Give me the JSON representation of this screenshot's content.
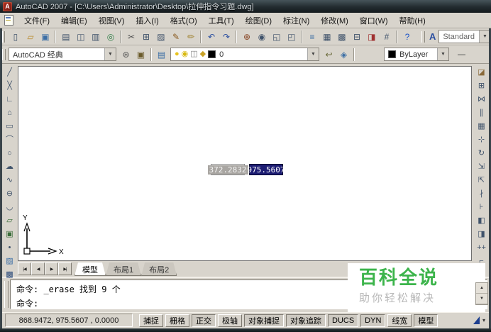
{
  "titlebar": {
    "logo_glyph": "A",
    "title": "AutoCAD 2007 - [C:\\Users\\Administrator\\Desktop\\拉伸指令习题.dwg]"
  },
  "menubar": {
    "items": [
      {
        "name": "file",
        "label": "文件(F)"
      },
      {
        "name": "edit",
        "label": "编辑(E)"
      },
      {
        "name": "view",
        "label": "视图(V)"
      },
      {
        "name": "insert",
        "label": "插入(I)"
      },
      {
        "name": "format",
        "label": "格式(O)"
      },
      {
        "name": "tools",
        "label": "工具(T)"
      },
      {
        "name": "draw",
        "label": "绘图(D)"
      },
      {
        "name": "dimension",
        "label": "标注(N)"
      },
      {
        "name": "modify",
        "label": "修改(M)"
      },
      {
        "name": "window",
        "label": "窗口(W)"
      },
      {
        "name": "help",
        "label": "帮助(H)"
      }
    ]
  },
  "toolbars": {
    "standard": {
      "groups": [
        [
          {
            "name": "new",
            "glyph": "▯"
          },
          {
            "name": "open",
            "glyph": "▱",
            "color": "#b98a2a"
          },
          {
            "name": "save",
            "glyph": "▣",
            "color": "#3b6ea5"
          }
        ],
        [
          {
            "name": "plot",
            "glyph": "▤"
          },
          {
            "name": "plot-preview",
            "glyph": "◫"
          },
          {
            "name": "publish",
            "glyph": "▥"
          },
          {
            "name": "etransmit",
            "glyph": "◎",
            "color": "#2e7d46"
          }
        ],
        [
          {
            "name": "cut",
            "glyph": "✂",
            "color": "#555555"
          },
          {
            "name": "copy",
            "glyph": "⊞"
          },
          {
            "name": "paste",
            "glyph": "▨"
          },
          {
            "name": "match-properties",
            "glyph": "✎",
            "color": "#8a5a1e"
          },
          {
            "name": "block-editor",
            "glyph": "✏",
            "color": "#9a7a20"
          }
        ],
        [
          {
            "name": "undo",
            "glyph": "↶",
            "color": "#2a4ea0"
          },
          {
            "name": "redo",
            "glyph": "↷",
            "color": "#2a4ea0"
          }
        ],
        [
          {
            "name": "pan",
            "glyph": "⊕",
            "color": "#8a4a2a"
          },
          {
            "name": "zoom-realtime",
            "glyph": "◉"
          },
          {
            "name": "zoom-window",
            "glyph": "◱"
          },
          {
            "name": "zoom-previous",
            "glyph": "◰"
          }
        ],
        [
          {
            "name": "properties",
            "glyph": "≡",
            "color": "#3b6ea5"
          },
          {
            "name": "designcenter",
            "glyph": "▦"
          },
          {
            "name": "tool-palettes",
            "glyph": "▩"
          },
          {
            "name": "sheet-set-manager",
            "glyph": "⊟"
          },
          {
            "name": "markup-set-manager",
            "glyph": "◨",
            "color": "#a03030"
          },
          {
            "name": "quickcalc",
            "glyph": "#"
          }
        ],
        [
          {
            "name": "help",
            "glyph": "?",
            "color": "#1a52c8"
          }
        ]
      ]
    },
    "styles": {
      "icon_glyph": "A",
      "text_style": "Standard"
    },
    "workspace": {
      "value": "AutoCAD 经典",
      "buttons": [
        {
          "name": "workspace-settings",
          "glyph": "⊛",
          "color": "#555555"
        },
        {
          "name": "workspace-save",
          "glyph": "▣",
          "color": "#6a5a2a"
        }
      ]
    },
    "layers": {
      "manager_button": {
        "name": "layer-properties-manager",
        "glyph": "▤",
        "color": "#3b6ea5"
      },
      "combo": {
        "icons": [
          {
            "name": "layer-on-bulb",
            "glyph": "●",
            "color": "#e8c31f"
          },
          {
            "name": "layer-freeze-sun",
            "glyph": "◉",
            "color": "#d8b90f"
          },
          {
            "name": "layer-plot",
            "glyph": "◫",
            "color": "#7a7a7a"
          },
          {
            "name": "layer-lock",
            "glyph": "◆",
            "color": "#c9a227"
          }
        ],
        "color_swatch": "#000000",
        "current_layer": "0"
      },
      "buttons_right": [
        {
          "name": "layer-previous",
          "glyph": "↩",
          "color": "#6a6a3a"
        },
        {
          "name": "layer-states",
          "glyph": "◈",
          "color": "#3b6ea5"
        }
      ],
      "color_combo": {
        "swatch": "#000000",
        "label": "ByLayer"
      },
      "linetype_hint": "—"
    }
  },
  "draw_tools": [
    {
      "name": "line",
      "glyph": "╱"
    },
    {
      "name": "construction-line",
      "glyph": "╳"
    },
    {
      "name": "polyline",
      "glyph": "∟"
    },
    {
      "name": "polygon",
      "glyph": "⌂"
    },
    {
      "name": "rectangle",
      "glyph": "▭"
    },
    {
      "name": "arc",
      "glyph": "⌒"
    },
    {
      "name": "circle",
      "glyph": "○"
    },
    {
      "name": "revision-cloud",
      "glyph": "☁"
    },
    {
      "name": "spline",
      "glyph": "∿"
    },
    {
      "name": "ellipse",
      "glyph": "⊖"
    },
    {
      "name": "ellipse-arc",
      "glyph": "◡"
    },
    {
      "name": "insert-block",
      "glyph": "▱",
      "color": "#3b6e3b"
    },
    {
      "name": "make-block",
      "glyph": "▣",
      "color": "#3b6e3b"
    },
    {
      "name": "point",
      "glyph": "•"
    },
    {
      "name": "hatch",
      "glyph": "▨",
      "color": "#3b6ea5"
    },
    {
      "name": "gradient",
      "glyph": "▩",
      "color": "#2a4a7a"
    }
  ],
  "modify_tools": [
    {
      "name": "erase",
      "glyph": "◪",
      "color": "#8a6a3a"
    },
    {
      "name": "copy-object",
      "glyph": "⊞"
    },
    {
      "name": "mirror",
      "glyph": "⋈"
    },
    {
      "name": "offset",
      "glyph": "∥"
    },
    {
      "name": "array",
      "glyph": "▦"
    },
    {
      "name": "move",
      "glyph": "⊹"
    },
    {
      "name": "rotate",
      "glyph": "↻"
    },
    {
      "name": "scale",
      "glyph": "⇲"
    },
    {
      "name": "stretch",
      "glyph": "⇱"
    },
    {
      "name": "trim",
      "glyph": "∤"
    },
    {
      "name": "extend",
      "glyph": "⊦"
    },
    {
      "name": "break-at-point",
      "glyph": "◧"
    },
    {
      "name": "break",
      "glyph": "◨"
    },
    {
      "name": "join",
      "glyph": "++"
    },
    {
      "name": "chamfer",
      "glyph": "⌐"
    },
    {
      "name": "fillet",
      "glyph": "╭"
    }
  ],
  "canvas": {
    "dyn_input": {
      "x_value": "372.2832",
      "y_value": "975.5607"
    },
    "ucs": {
      "x_label": "X",
      "y_label": "Y"
    }
  },
  "sheet_tabs": {
    "nav": [
      {
        "name": "first",
        "glyph": "|◀"
      },
      {
        "name": "prev",
        "glyph": "◀"
      },
      {
        "name": "next",
        "glyph": "▶"
      },
      {
        "name": "last",
        "glyph": "▶|"
      }
    ],
    "tabs": [
      {
        "name": "model",
        "label": "模型",
        "active": true
      },
      {
        "name": "layout1",
        "label": "布局1",
        "active": false
      },
      {
        "name": "layout2",
        "label": "布局2",
        "active": false
      }
    ]
  },
  "command_window": {
    "lines": [
      "命令: _erase 找到 9 个",
      "命令:"
    ]
  },
  "statusbar": {
    "coords": "868.9472,  975.5607 , 0.0000",
    "toggles": [
      {
        "name": "snap",
        "label": "捕捉",
        "pressed": false
      },
      {
        "name": "grid",
        "label": "栅格",
        "pressed": false
      },
      {
        "name": "ortho",
        "label": "正交",
        "pressed": true
      },
      {
        "name": "polar",
        "label": "极轴",
        "pressed": false
      },
      {
        "name": "osnap",
        "label": "对象捕捉",
        "pressed": true
      },
      {
        "name": "otrack",
        "label": "对象追踪",
        "pressed": true
      },
      {
        "name": "ducs",
        "label": "DUCS",
        "pressed": true
      },
      {
        "name": "dyn",
        "label": "DYN",
        "pressed": true
      },
      {
        "name": "lineweight",
        "label": "线宽",
        "pressed": false
      },
      {
        "name": "model-space",
        "label": "模型",
        "pressed": true
      }
    ],
    "menu_arrow": "▾"
  },
  "watermark": {
    "title": "百科全说",
    "subtitle": "助你轻松解决",
    "accent_color": "#3cb44b"
  }
}
